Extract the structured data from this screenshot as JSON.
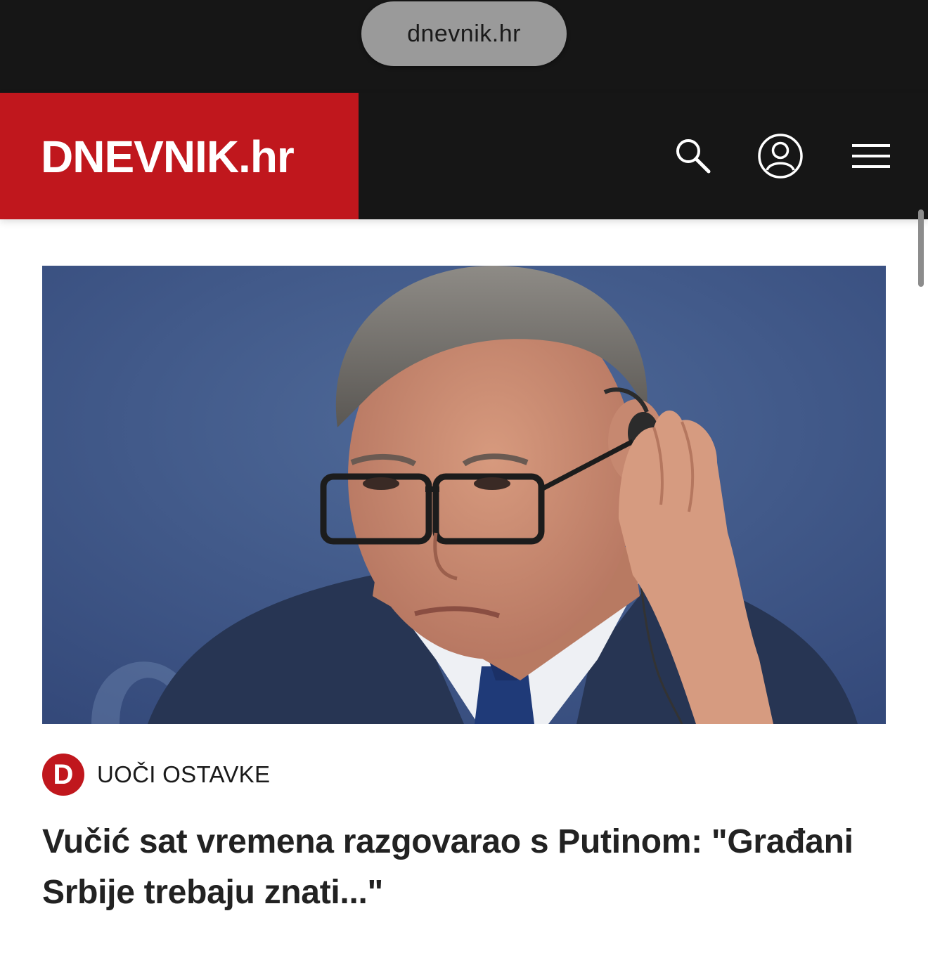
{
  "browser": {
    "url": "dnevnik.hr"
  },
  "header": {
    "logo": "DNEVNIK.hr",
    "icons": [
      "search-icon",
      "user-account-icon",
      "hamburger-menu-icon"
    ],
    "colors": {
      "brand": "#c0171d",
      "background": "#161616"
    }
  },
  "article": {
    "image_alt": "Photo of a man with glasses holding an earpiece",
    "badge_letter": "D",
    "tag": "UOČI OSTAVKE",
    "headline": "Vučić sat vremena razgovarao s Putinom: \"Građani Srbije trebaju znati...\""
  }
}
